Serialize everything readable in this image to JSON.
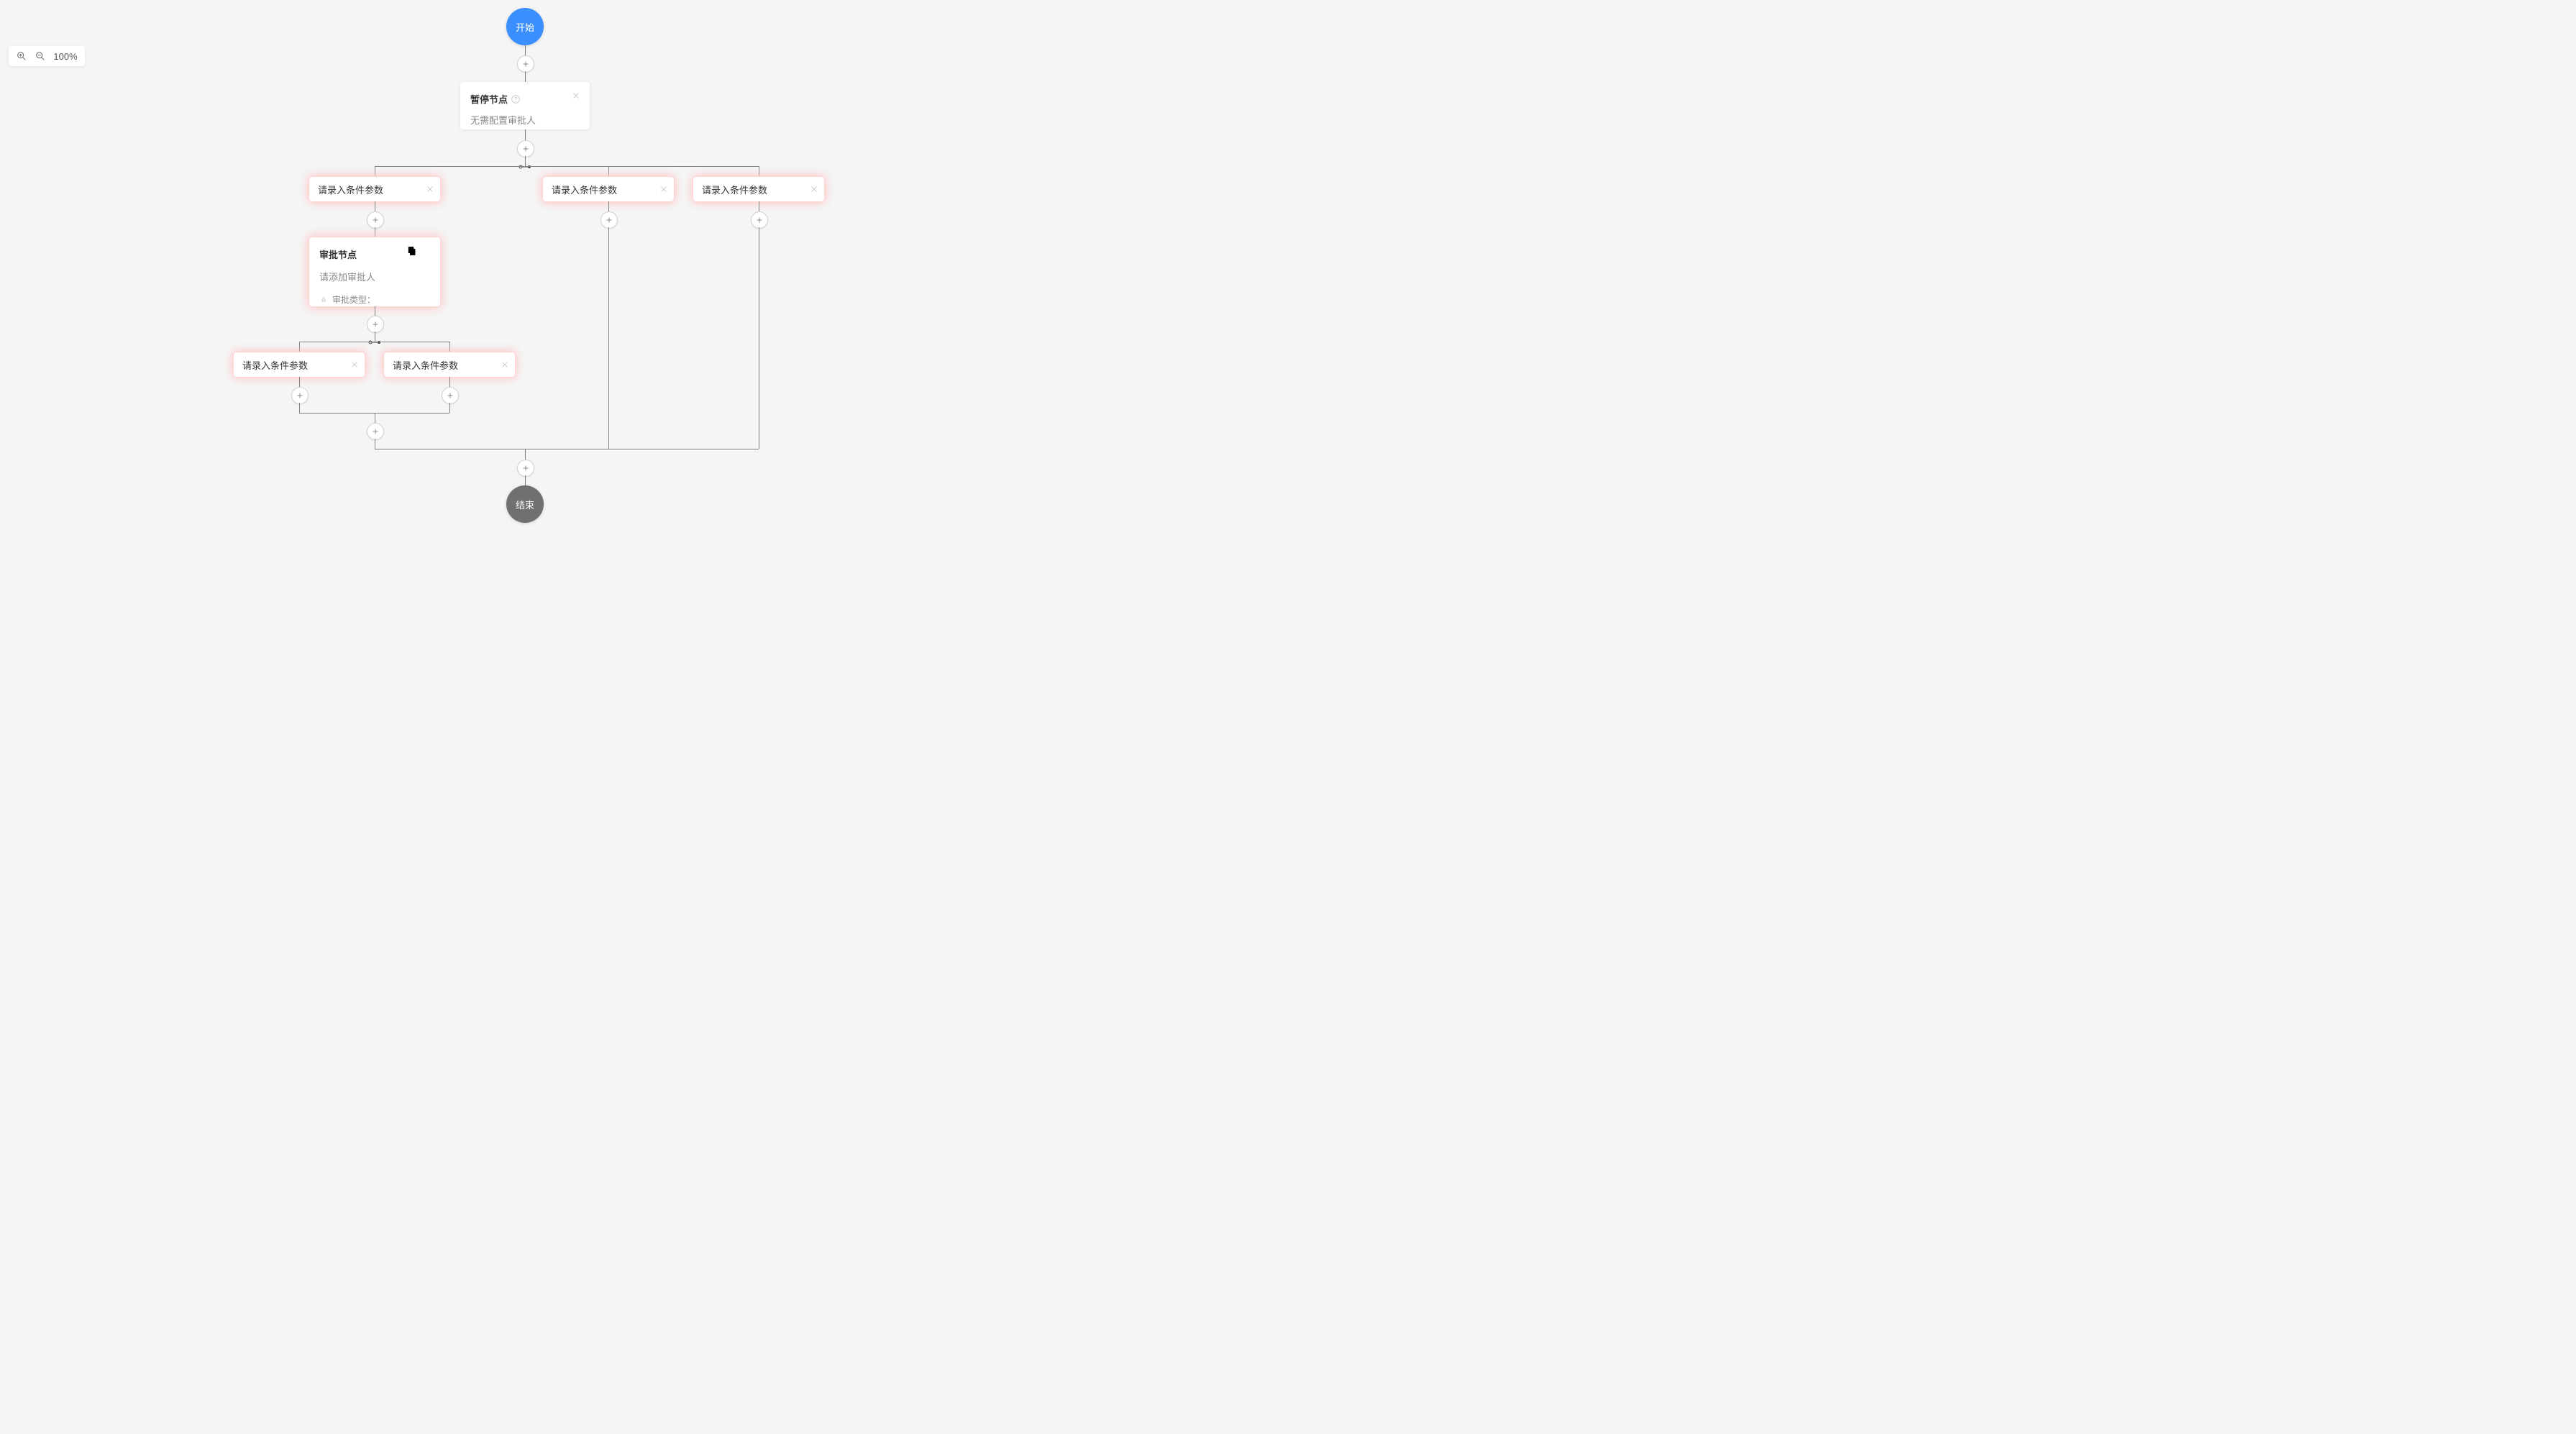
{
  "zoom": {
    "level": "100%"
  },
  "nodes": {
    "start": {
      "label": "开始"
    },
    "end": {
      "label": "结束"
    },
    "pause": {
      "title": "暂停节点",
      "subtitle": "无需配置审批人"
    },
    "approval": {
      "title": "审批节点",
      "subtitle": "请添加审批人",
      "type_label": "审批类型："
    }
  },
  "branches": {
    "top": {
      "b1": {
        "label": "请录入条件参数"
      },
      "b2": {
        "label": "请录入条件参数"
      },
      "b3": {
        "label": "请录入条件参数"
      }
    },
    "nested": {
      "n1": {
        "label": "请录入条件参数"
      },
      "n2": {
        "label": "请录入条件参数"
      }
    }
  }
}
